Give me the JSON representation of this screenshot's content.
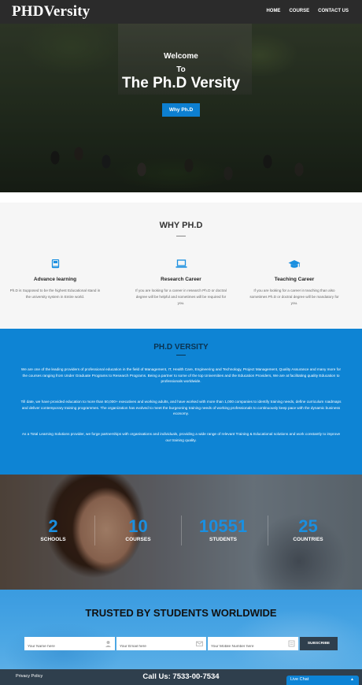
{
  "nav": {
    "logo": "PHDVersity",
    "links": [
      "HOME",
      "COURSE",
      "CONTACT US"
    ]
  },
  "hero": {
    "welcome": "Welcome",
    "to": "To",
    "title": "The Ph.D Versity",
    "button": "Why Ph.D"
  },
  "why": {
    "title": "WHY PH.D",
    "features": [
      {
        "icon": "book-icon",
        "title": "Advance learning",
        "text": "Ph.D is Supposed to be the highest Educational stand in the university system in Entire world."
      },
      {
        "icon": "laptop-icon",
        "title": "Research Career",
        "text": "If you are looking for a career in research Ph.D or doctral degree will be helpful and sometimes will be required for you."
      },
      {
        "icon": "graduation-cap-icon",
        "title": "Teaching Career",
        "text": "If you are looking for a career in teaching than also sometimes Ph.D or doctral degree will be mandatory for you."
      }
    ]
  },
  "about": {
    "title": "PH.D VERSITY",
    "paragraphs": [
      "We are one of the leading providers of professional education in the field of Management, IT, Health Care, Engineering and Technology, Project Management, Quality Assurance and many more for the courses ranging from Under Graduate Programs to Research Programs. Being a partner to some of the top Universities and the Education Providers, We are at facilitating quality Education to professionals worldwide.",
      "Till date, we have provided education to more than 50,000+ executives and working adults, and have worked with more than 1,000 companies to identify training needs, define curriculum roadmaps and deliver contemporary training programmes. The organization has evolved to meet the burgeoning training needs of working professionals to continuously keep pace with the dynamic business economy.",
      "As a Total Learning Solutions provider, we forge partnerships with organisations and individuals, providing a wide range of relevant Training & Educational solutions and work constantly to improve our training quality."
    ]
  },
  "stats": [
    {
      "number": "2",
      "label": "SCHOOLS"
    },
    {
      "number": "10",
      "label": "COURSES"
    },
    {
      "number": "10551",
      "label": "STUDENTS"
    },
    {
      "number": "25",
      "label": "COUNTRIES"
    }
  ],
  "trusted": {
    "title": "TRUSTED BY STUDENTS WORLDWIDE",
    "name_placeholder": "Your Name here",
    "email_placeholder": "Your Email here",
    "mobile_placeholder": "Your Mobile Number here",
    "subscribe": "SUBSCRIBE"
  },
  "footer": {
    "privacy": "Privacy Policy",
    "call": "Call Us: 7533-00-7534",
    "livechat": "Live Chat"
  },
  "colors": {
    "accent": "#0e84d4",
    "nav_bg": "#2b2b2b",
    "footer_bg": "#2f3f4d",
    "stat_number": "#1a8fe0"
  }
}
